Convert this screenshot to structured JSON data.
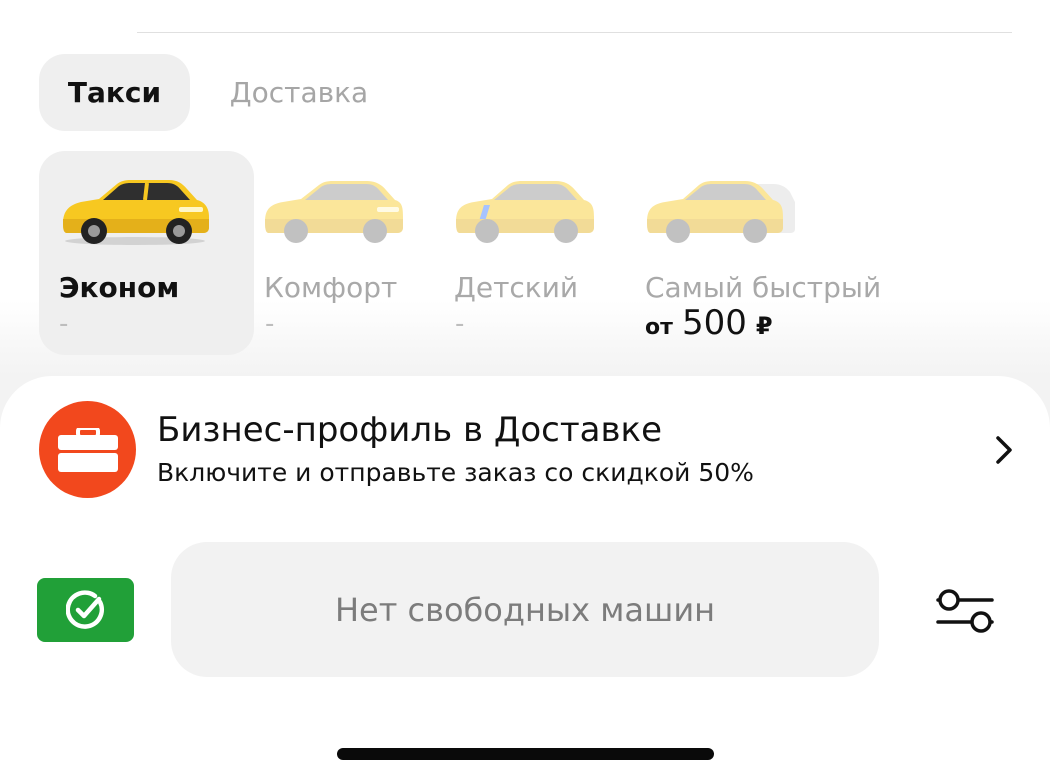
{
  "tabs": {
    "taxi": "Такси",
    "delivery": "Доставка"
  },
  "tariffs": [
    {
      "name": "Эконом",
      "price": "-",
      "selected": true
    },
    {
      "name": "Комфорт",
      "price": "-"
    },
    {
      "name": "Детский",
      "price": "-"
    },
    {
      "name": "Самый быстрый",
      "price_prefix": "от",
      "price_value": "500",
      "price_currency": "₽"
    }
  ],
  "promo": {
    "title": "Бизнес-профиль в Доставке",
    "subtitle": "Включите и отправьте заказ со скидкой 50%"
  },
  "order": {
    "button_label": "Нет свободных машин"
  },
  "colors": {
    "taxi_yellow": "#f7c821",
    "promo_orange": "#f2481d",
    "pay_green": "#21a038"
  },
  "icons": {
    "promo": "briefcase-icon",
    "payment": "sber-check-icon",
    "settings": "sliders-icon",
    "chevron": "chevron-right-icon"
  }
}
